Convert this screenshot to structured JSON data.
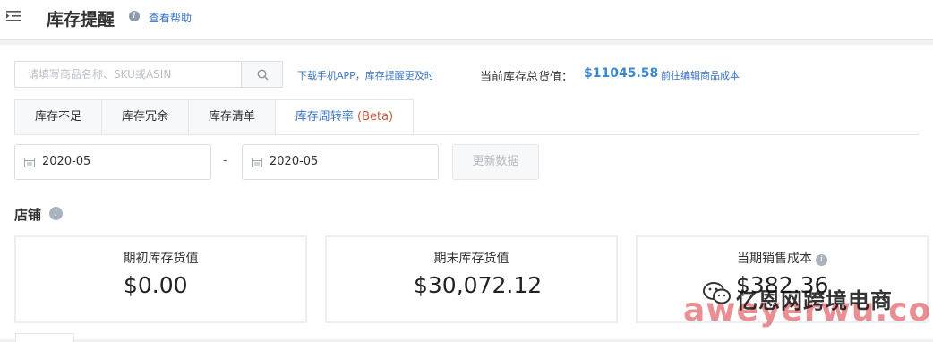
{
  "header": {
    "title": "库存提醒",
    "help_link": "查看帮助",
    "help_icon": "info-icon",
    "menu_icon": "menu-collapse-icon"
  },
  "toolbar": {
    "search_placeholder": "请填写商品名称、SKU或ASIN",
    "search_icon": "search-icon",
    "app_link": "下载手机APP，库存提醒更及时",
    "value_label": "当前库存总货值：",
    "value_amount": "$11045.58",
    "cost_link": "前往编辑商品成本"
  },
  "tabs": [
    {
      "label": "库存不足"
    },
    {
      "label": "库存冗余"
    },
    {
      "label": "库存清单"
    },
    {
      "label": "库存周转率 ",
      "suffix": "(Beta)",
      "active": true
    }
  ],
  "filters": {
    "start_date": "2020-05",
    "separator": "-",
    "end_date": "2020-05",
    "update_button": "更新数据",
    "calendar_icon": "calendar-icon"
  },
  "section": {
    "title": "店铺",
    "info_icon": "info-icon"
  },
  "cards": [
    {
      "label": "期初库存货值",
      "value": "$0.00"
    },
    {
      "label": "期末库存货值",
      "value": "$30,072.12"
    },
    {
      "label": "当期销售成本",
      "value": "$382.36",
      "info_icon": "info-icon"
    }
  ],
  "watermark": {
    "text_cn": "亿恩网跨境电商",
    "text_en": "aweyerwu.com",
    "logo_icon": "wechat-logo-icon"
  },
  "colors": {
    "accent": "#3a74c4",
    "value_blue": "#3a87c9",
    "beta_red": "#c85a3a",
    "watermark_red": "#d8343c"
  }
}
